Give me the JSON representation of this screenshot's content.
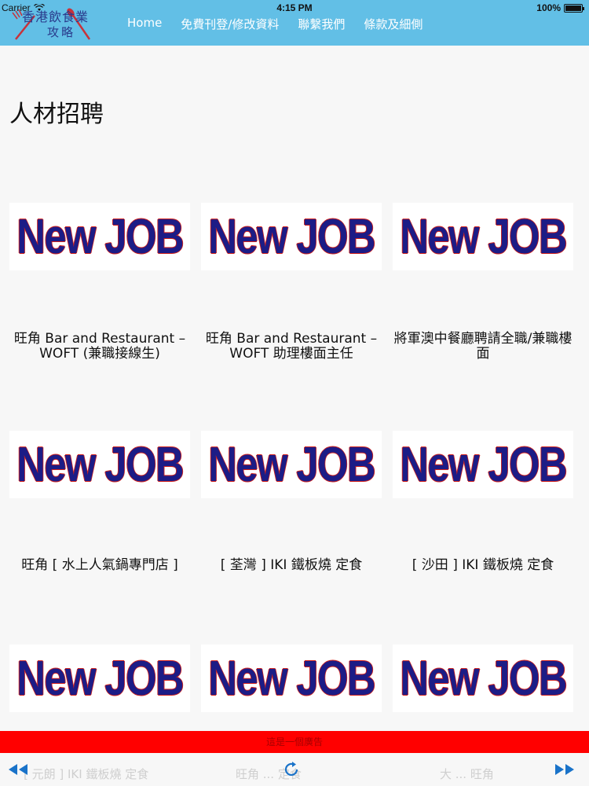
{
  "status_bar": {
    "carrier": "Carrier",
    "time": "4:15 PM",
    "battery": "100%",
    "battery_level": 1.0
  },
  "header": {
    "logo_title": "香港飲食業",
    "logo_subtitle": "攻略",
    "nav": [
      "Home",
      "免費刊登/修改資料",
      "聯繫我們",
      "條款及細側"
    ]
  },
  "page_title": "人材招聘",
  "job_image_text": "New JOB",
  "jobs": [
    {
      "title": "旺角 Bar and Restaurant – WOFT (兼職接線生)"
    },
    {
      "title": "旺角 Bar and Restaurant – WOFT 助理樓面主任"
    },
    {
      "title": "將軍澳中餐廳聘請全職/兼職樓面"
    },
    {
      "title": "旺角 [ 水上人氣鍋專門店 ]"
    },
    {
      "title": "[ 荃灣 ] IKI 鐵板燒 定食"
    },
    {
      "title": "[ 沙田 ] IKI 鐵板燒 定食"
    },
    {
      "title": ""
    },
    {
      "title": ""
    },
    {
      "title": ""
    }
  ],
  "ad_bar": "這是一個廣告",
  "bottom_ghost": [
    "[ 元朗 ] IKI 鐵板燒 定食",
    "旺角 ... 定食",
    "大 ... 旺角"
  ],
  "colors": {
    "header_bg": "#62bfe6",
    "job_text": "#1c1c86",
    "job_outline": "#d4231d",
    "ad_bar": "#ff0000",
    "toolbar_icon": "#1a73c9"
  },
  "icons": {
    "back": "rewind-icon",
    "reload": "reload-icon",
    "forward": "fast-forward-icon"
  }
}
